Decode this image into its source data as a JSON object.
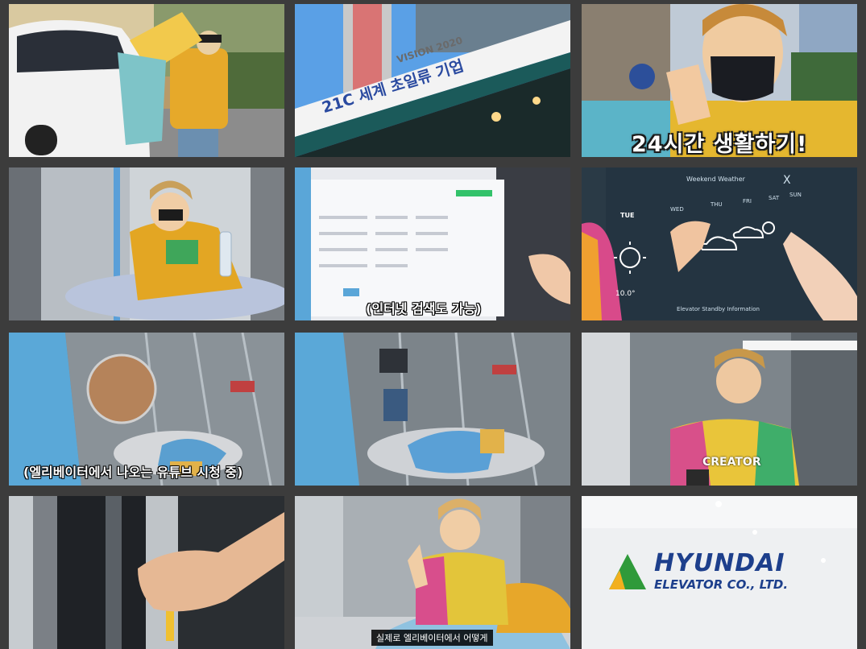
{
  "grid": {
    "background": "#3c3c3c",
    "frames": [
      {
        "id": "frame-1",
        "scene": "car-pillow",
        "caption": ""
      },
      {
        "id": "frame-2",
        "scene": "building-sign",
        "caption": ""
      },
      {
        "id": "frame-3",
        "scene": "host-mask-wave",
        "caption": "24시간 생활하기!"
      },
      {
        "id": "frame-4",
        "scene": "host-sitting-water",
        "caption": ""
      },
      {
        "id": "frame-5",
        "scene": "screen-browser",
        "caption": "(인터넷 검색도 가능)"
      },
      {
        "id": "frame-6",
        "scene": "screen-weather",
        "caption": ""
      },
      {
        "id": "frame-7",
        "scene": "cctv-elevator-1",
        "caption": "(엘리베이터에서 나오는 유튜브 시청 중)"
      },
      {
        "id": "frame-8",
        "scene": "cctv-elevator-2",
        "caption": ""
      },
      {
        "id": "frame-9",
        "scene": "host-creator-shirt",
        "caption": ""
      },
      {
        "id": "frame-10",
        "scene": "door-hand",
        "caption": ""
      },
      {
        "id": "frame-11",
        "scene": "host-blanket-wave",
        "caption": "실제로 엘리베이터에서 어떻게"
      },
      {
        "id": "frame-12",
        "scene": "hyundai-logo",
        "caption": ""
      }
    ]
  },
  "signs": {
    "building_top": "VISION 2020",
    "building_main": "21C 세계 초일류 기업",
    "shirt_text": "CREATOR",
    "weather_header": "Weekend Weather",
    "weather_close": "X",
    "weather_days": [
      "TUE",
      "WED",
      "THU",
      "FRI",
      "SAT",
      "SUN"
    ],
    "weather_temp": "10.0°",
    "weather_footer": "Elevator Standby Information"
  },
  "logo": {
    "line1": "HYUNDAI",
    "line2": "ELEVATOR CO., LTD.",
    "brand_blue": "#1d3f8c",
    "triangle_green": "#2f9a3a",
    "triangle_yellow": "#f2b01e"
  }
}
